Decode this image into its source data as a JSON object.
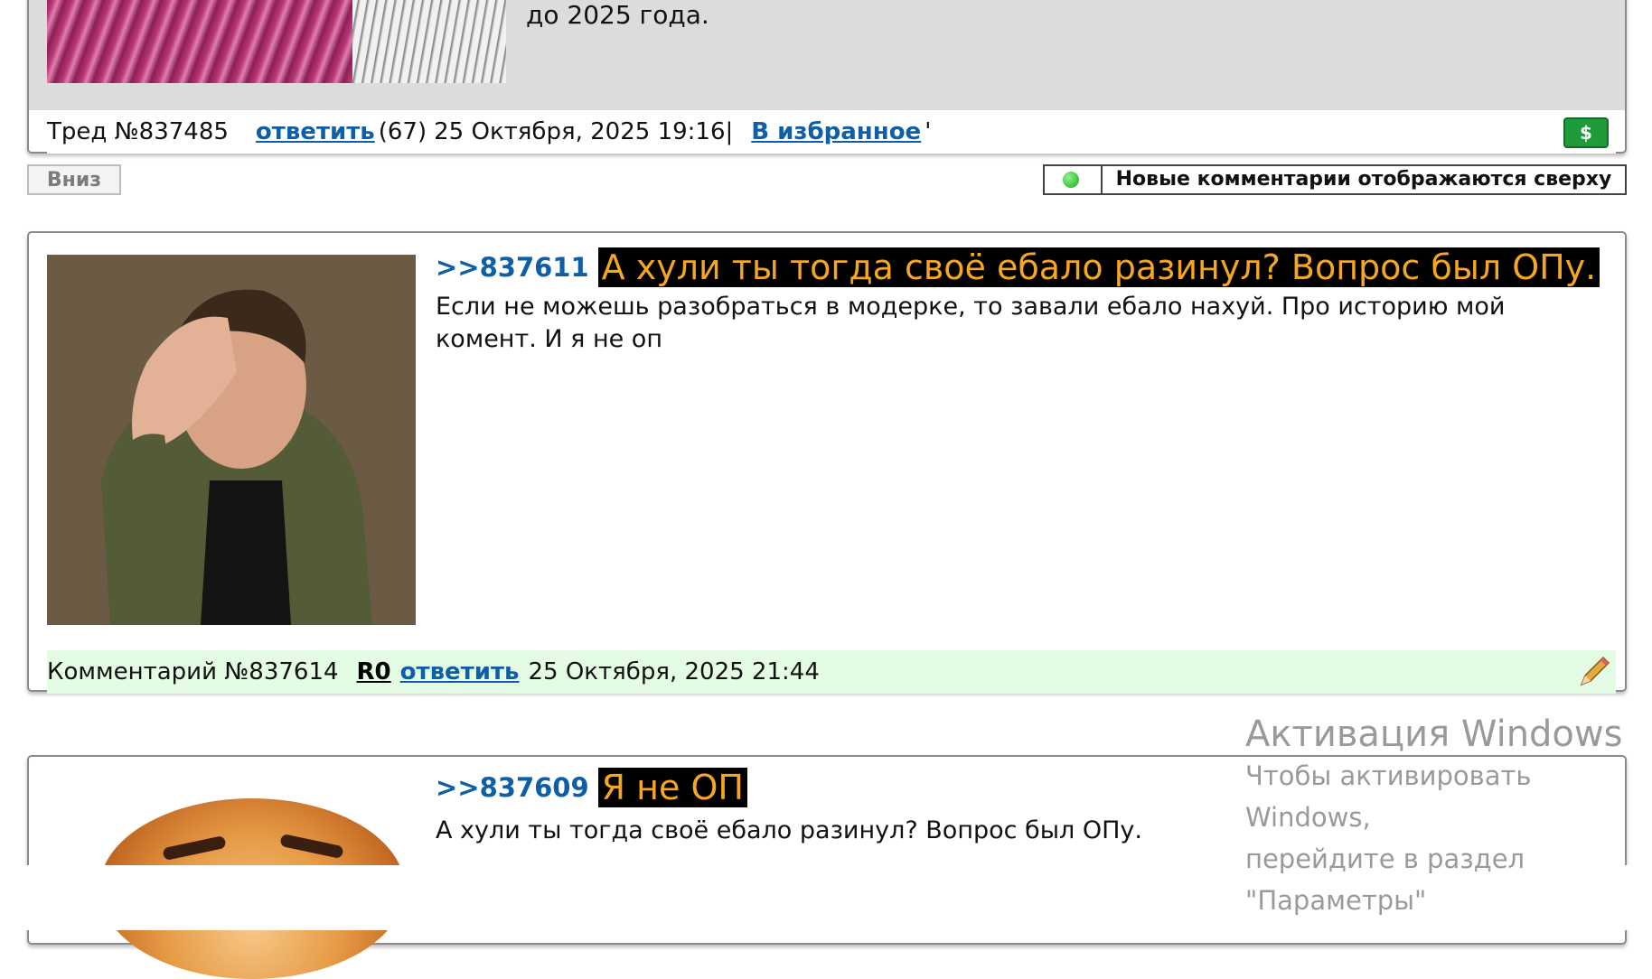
{
  "thread": {
    "intro_tail": "до 2025 года.",
    "number_label": "Тред №837485",
    "reply_label": "ответить",
    "reply_count": "(67)",
    "date": "25 Октября, 2025 19:16|",
    "favorite_label": "В избранное",
    "favorite_tail": "'",
    "money_badge": "$"
  },
  "toolbar": {
    "down_label": "Вниз",
    "sort_label": "Новые комментарии отображаются сверху"
  },
  "comments": [
    {
      "ref": ">>837611",
      "quote": "А хули ты тогда своё ебало разинул? Вопрос был ОПу.",
      "text": "Если не можешь разобраться в модерке, то завали ебало нахуй. Про историю мой комент. И я не оп",
      "number_label": "Комментарий №837614",
      "author": "R0",
      "reply_label": "ответить",
      "date": "25 Октября, 2025 21:44"
    },
    {
      "ref": ">>837609",
      "quote": "Я не ОП",
      "text": "А хули ты тогда своё ебало разинул? Вопрос был ОПу."
    }
  ],
  "watermark": {
    "title": "Активация Windows",
    "line1": "Чтобы активировать Windows,",
    "line2": "перейдите в раздел \"Параметры\""
  },
  "colors": {
    "link": "#0f5ea8",
    "quote_text": "#f5a623",
    "quote_bg": "#000000",
    "comment_footer_bg": "#e4fbe4"
  }
}
